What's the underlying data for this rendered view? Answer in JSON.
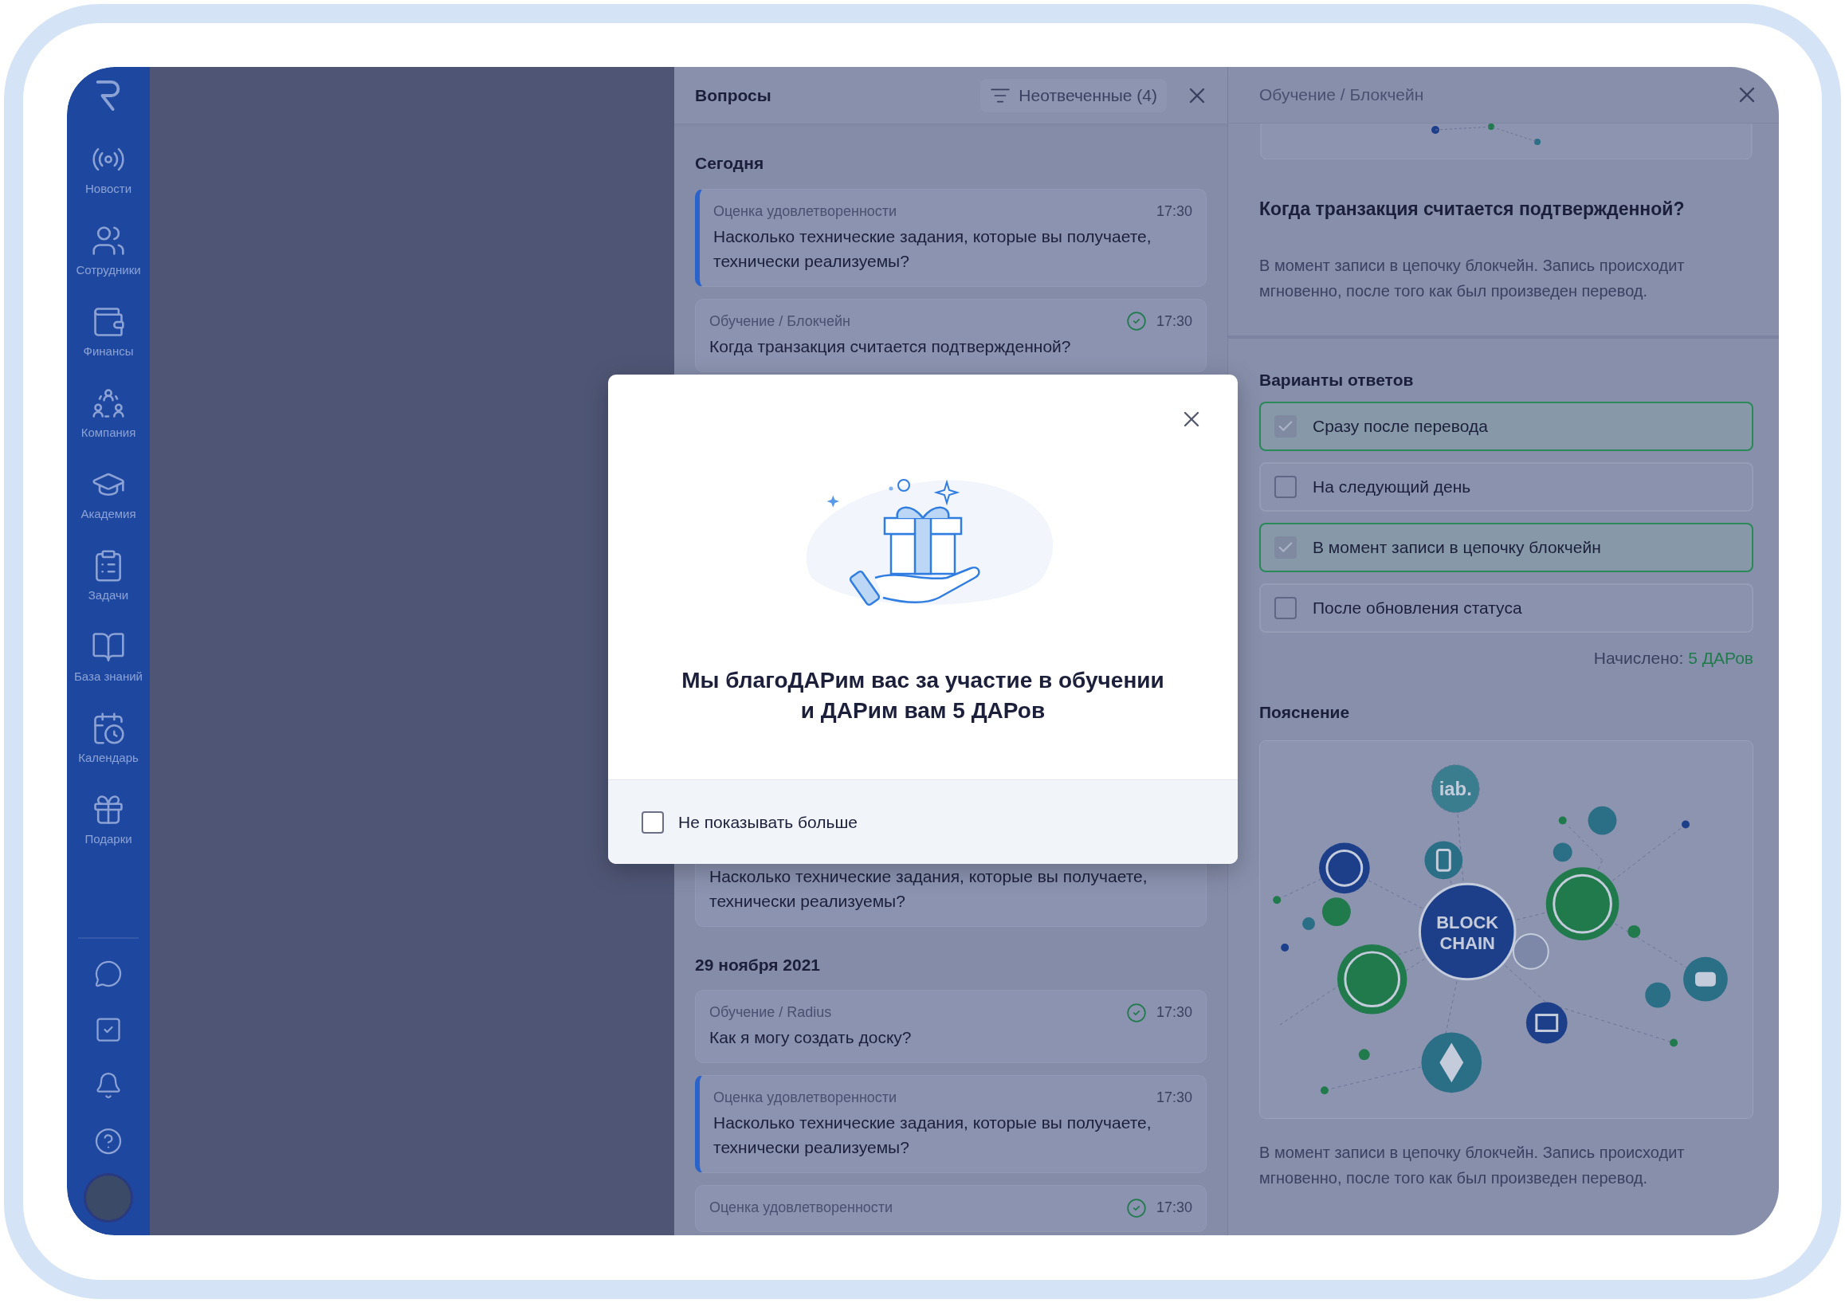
{
  "sidebar": {
    "nav_items": [
      {
        "label": "Новости"
      },
      {
        "label": "Сотрудники"
      },
      {
        "label": "Финансы"
      },
      {
        "label": "Компания"
      },
      {
        "label": "Академия"
      },
      {
        "label": "Задачи"
      },
      {
        "label": "База знаний"
      },
      {
        "label": "Календарь"
      },
      {
        "label": "Подарки"
      }
    ]
  },
  "questions_panel": {
    "title": "Вопросы",
    "filter": "Неотвеченные (4)",
    "groups": [
      {
        "date": "Сегодня",
        "items": [
          {
            "category": "Оценка удовлетворенности",
            "time": "17:30",
            "question": "Насколько технические задания, которые вы получаете, технически реализуемы?",
            "highlighted": true,
            "answered": false
          },
          {
            "category": "Обучение / Блокчейн",
            "time": "17:30",
            "question": "Когда транзакция считается подтвержденной?",
            "highlighted": false,
            "answered": true
          },
          {
            "question": "Насколько технические задания, которые вы получаете, технически реализуемы?",
            "highlighted": false
          }
        ]
      },
      {
        "date": "29 ноября 2021",
        "items": [
          {
            "category": "Обучение / Radius",
            "time": "17:30",
            "question": "Как я могу создать доску?",
            "highlighted": false,
            "answered": true
          },
          {
            "category": "Оценка удовлетворенности",
            "time": "17:30",
            "question": "Насколько технические задания, которые вы получаете, технически реализуемы?",
            "highlighted": true,
            "answered": false
          },
          {
            "category": "Оценка удовлетворенности",
            "time": "17:30",
            "highlighted": false,
            "answered": true
          }
        ]
      }
    ]
  },
  "detail_panel": {
    "breadcrumb": "Обучение / Блокчейн",
    "question": "Когда транзакция считается подтвержденной?",
    "answer_text": "В момент записи в цепочку блокчейн. Запись происходит мгновенно, после того как был произведен перевод.",
    "options_title": "Варианты ответов",
    "options": [
      {
        "label": "Сразу после перевода",
        "checked": true
      },
      {
        "label": "На следующий день",
        "checked": false
      },
      {
        "label": "В момент записи в цепочку блокчейн",
        "checked": true
      },
      {
        "label": "После обновления статуса",
        "checked": false
      }
    ],
    "awarded_label": "Начислено:",
    "awarded_value": "5 ДАРов",
    "explanation_title": "Пояснение",
    "illustration_texts": [
      "iab.",
      "BLOCK",
      "CHAIN"
    ],
    "explanation_text": "В момент записи в цепочку блокчейн. Запись происходит мгновенно, после того как был произведен перевод."
  },
  "modal": {
    "title_lines": [
      "Мы благоДАРим вас за участие в обучении",
      "и ДАРим вам 5 ДАРов"
    ],
    "dont_show_again": {
      "label": "Не показывать больше",
      "checked": false
    }
  }
}
